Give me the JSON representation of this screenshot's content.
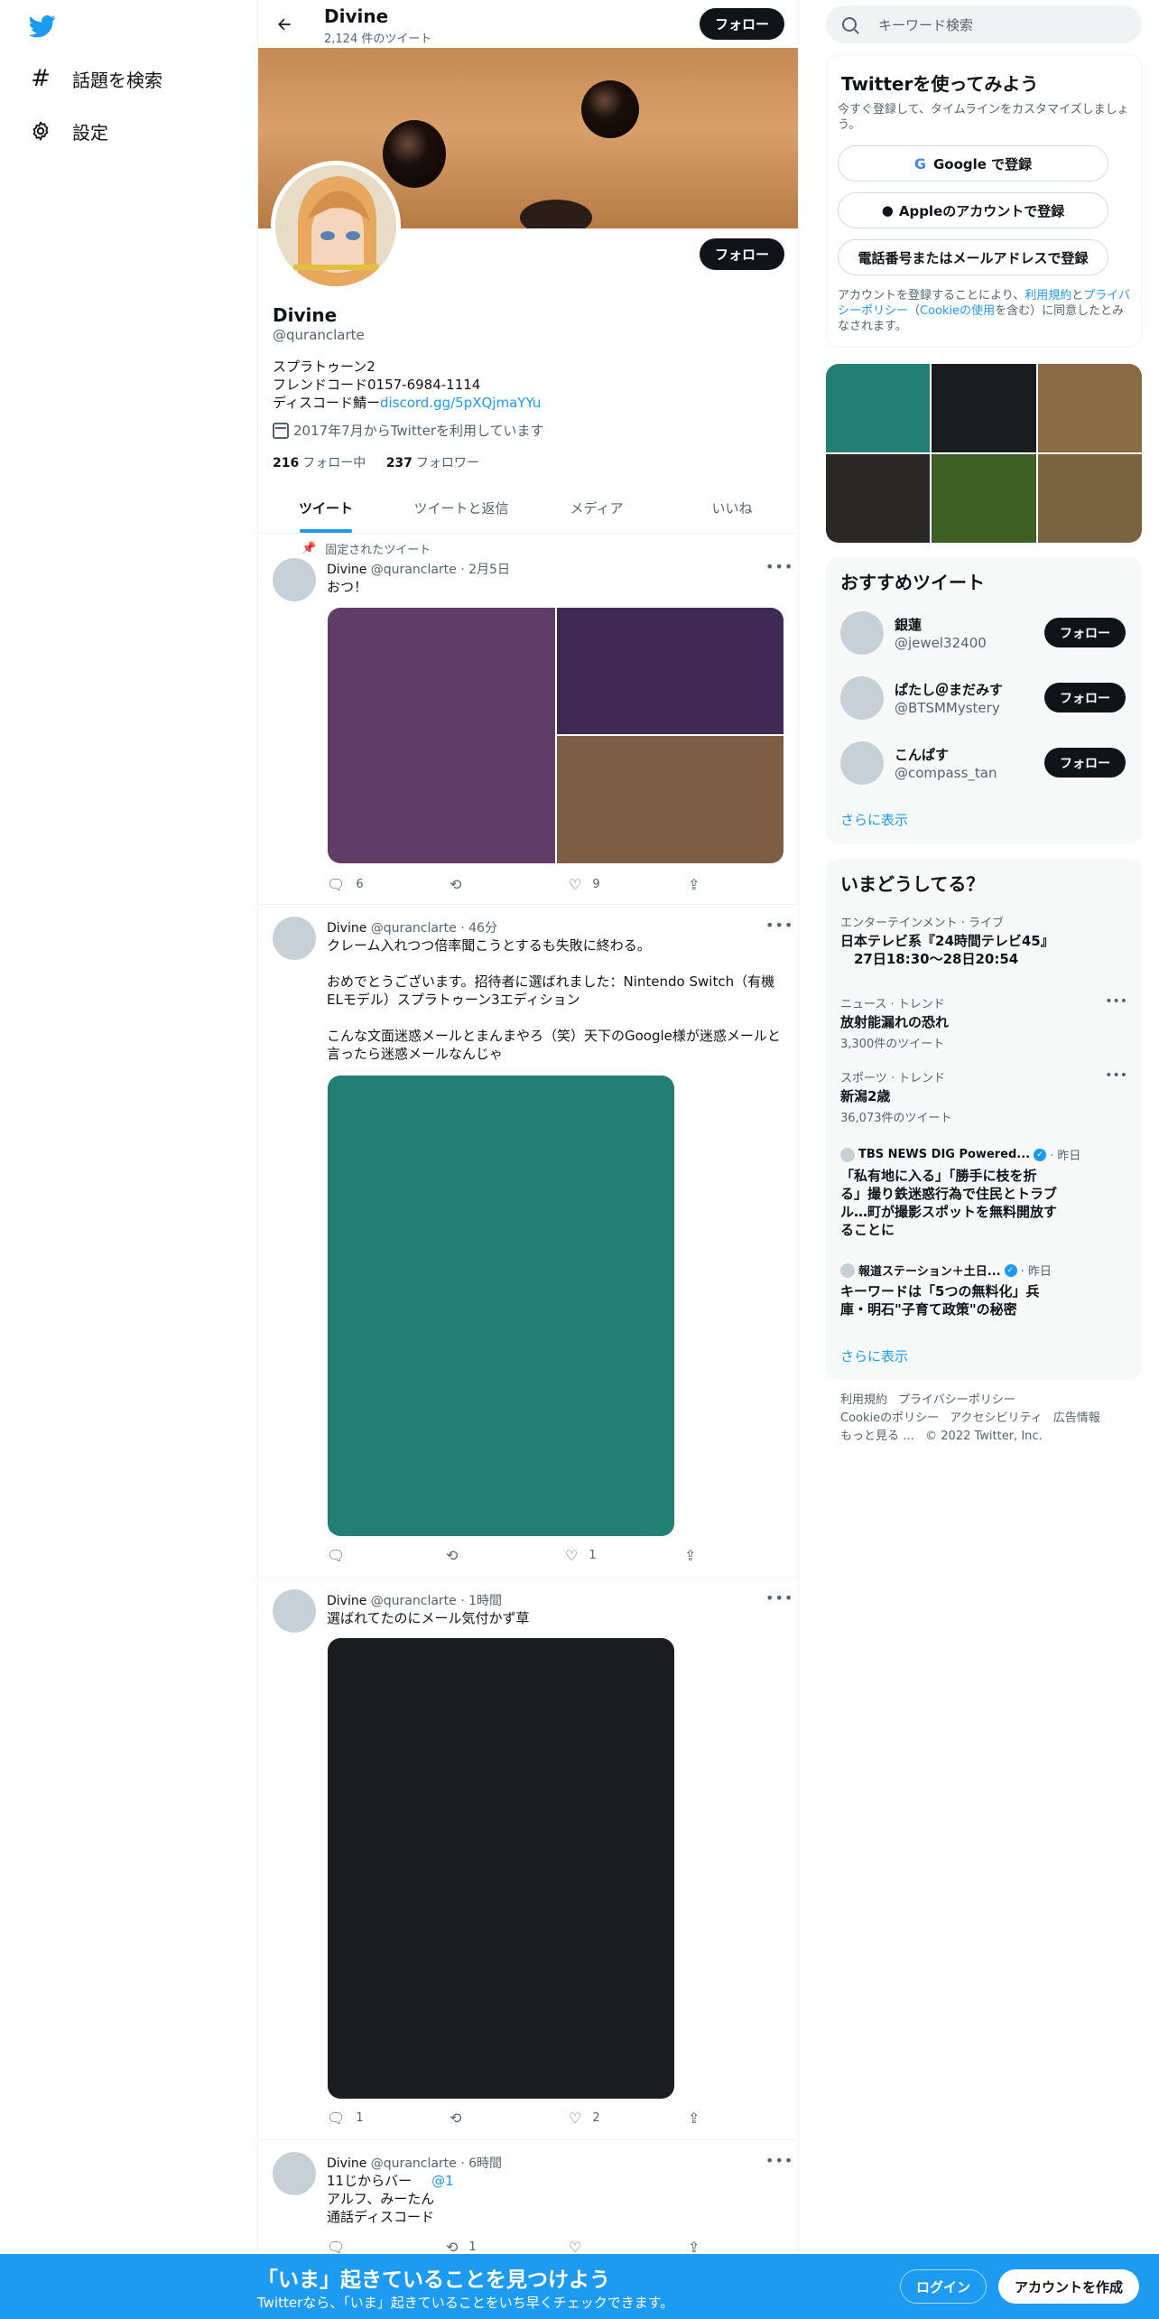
{
  "nav": {
    "items": [
      {
        "label": "話題を検索",
        "icon": "hash-icon"
      },
      {
        "label": "設定",
        "icon": "gear-icon"
      }
    ]
  },
  "header": {
    "name": "Divine",
    "tweet_count": "2,124 件のツイート",
    "follow_label": "フォロー"
  },
  "profile": {
    "name": "Divine",
    "handle": "@quranclarte",
    "bio_line1": "スプラトゥーン2",
    "bio_line2": "フレンドコード0157-6984-1114",
    "bio_line3_prefix": "ディスコード鯖ー",
    "bio_link": "discord.gg/5pXQjmaYYu",
    "joined": "2017年7月からTwitterを利用しています",
    "following_count": "216",
    "following_label": "フォロー中",
    "followers_count": "237",
    "followers_label": "フォロワー",
    "follow_label": "フォロー"
  },
  "tabs": [
    {
      "label": "ツイート",
      "active": true
    },
    {
      "label": "ツイートと返信",
      "active": false
    },
    {
      "label": "メディア",
      "active": false
    },
    {
      "label": "いいね",
      "active": false
    }
  ],
  "tweets": [
    {
      "pinned_label": "固定されたツイート",
      "name": "Divine",
      "handle_time": "@quranclarte · 2月5日",
      "text": "おつ！",
      "replies": "6",
      "retweets": "",
      "likes": "9",
      "media_colors": [
        "#603d67",
        "#3e2a54",
        "#7d5d44"
      ]
    },
    {
      "name": "Divine",
      "handle_time": "@quranclarte · 46分",
      "text": "クレーム入れつつ倍率聞こうとするも失敗に終わる。\n\nおめでとうございます。招待者に選ばれました：Nintendo Switch（有機ELモデル）スプラトゥーン3エディション\n\nこんな文面迷惑メールとまんまやろ（笑）天下のGoogle様が迷惑メールと言ったら迷惑メールなんじゃ",
      "replies": "",
      "retweets": "",
      "likes": "1",
      "media_colors": [
        "#237e73"
      ]
    },
    {
      "name": "Divine",
      "handle_time": "@quranclarte · 1時間",
      "text": "選ばれてたのにメール気付かず草",
      "replies": "1",
      "retweets": "",
      "likes": "2",
      "media_colors": [
        "#1a1c1f"
      ]
    },
    {
      "name": "Divine",
      "handle_time": "@quranclarte · 6時間",
      "text_line1": "11じからバー",
      "mention": "@1",
      "text_rest": "アルフ、みーたん\n通話ディスコード",
      "replies": "",
      "retweets": "1",
      "likes": ""
    }
  ],
  "search": {
    "placeholder": "キーワード検索"
  },
  "signup": {
    "title": "Twitterを使ってみよう",
    "subtitle": "今すぐ登録して、タイムラインをカスタマイズしましょう。",
    "google": "Google で登録",
    "apple": "Appleのアカウントで登録",
    "phone": "電話番号またはメールアドレスで登録",
    "legal_prefix": "アカウントを登録することにより、",
    "legal_terms": "利用規約",
    "legal_and": "と",
    "legal_privacy": "プライバシーポリシー",
    "legal_paren_open": "（",
    "legal_cookie": "Cookieの使用",
    "legal_suffix": "を含む）に同意したとみなされます。"
  },
  "photos": {
    "colors": [
      "#237e73",
      "#1a1c1f",
      "#8a6a44",
      "#2a2825",
      "#3d5e25",
      "#7a6440"
    ]
  },
  "recommended": {
    "title": "おすすめツイート",
    "users": [
      {
        "name": "銀蓮",
        "handle": "@jewel32400",
        "follow": "フォロー"
      },
      {
        "name": "ぱたし＠まだみす",
        "handle": "@BTSMMystery",
        "follow": "フォロー"
      },
      {
        "name": "こんぱす",
        "handle": "@compass_tan",
        "follow": "フォロー"
      }
    ],
    "show_more": "さらに表示"
  },
  "trends": {
    "title": "いまどうしてる？",
    "items": [
      {
        "category": "エンターテインメント · ライブ",
        "name": "日本テレビ系『24時間テレビ45』\n　27日18:30〜28日20:54",
        "count": ""
      },
      {
        "category": "ニュース · トレンド",
        "name": "放射能漏れの恐れ",
        "count": "3,300件のツイート"
      },
      {
        "category": "スポーツ · トレンド",
        "name": "新潟2歳",
        "count": "36,073件のツイート"
      }
    ],
    "news": [
      {
        "source": "TBS NEWS DIG Powered...",
        "time": "· 昨日",
        "title": "「私有地に入る」「勝手に枝を折る」撮り鉄迷惑行為で住民とトラブル…町が撮影スポットを無料開放することに"
      },
      {
        "source": "報道ステーション＋土日...",
        "time": "· 昨日",
        "title": "キーワードは「5つの無料化」兵庫・明石\"子育て政策\"の秘密"
      }
    ],
    "show_more": "さらに表示"
  },
  "footer": {
    "links": [
      "利用規約",
      "プライバシーポリシー",
      "Cookieのポリシー",
      "アクセシビリティ",
      "広告情報",
      "もっと見る …"
    ],
    "copyright": "© 2022 Twitter, Inc."
  },
  "bottom": {
    "title": "「いま」起きていることを見つけよう",
    "subtitle": "Twitterなら、「いま」起きていることをいち早くチェックできます。",
    "login": "ログイン",
    "signup": "アカウントを作成"
  },
  "colors": {
    "accent": "#1d9bf0",
    "text": "#0f1419",
    "muted": "#536471"
  }
}
